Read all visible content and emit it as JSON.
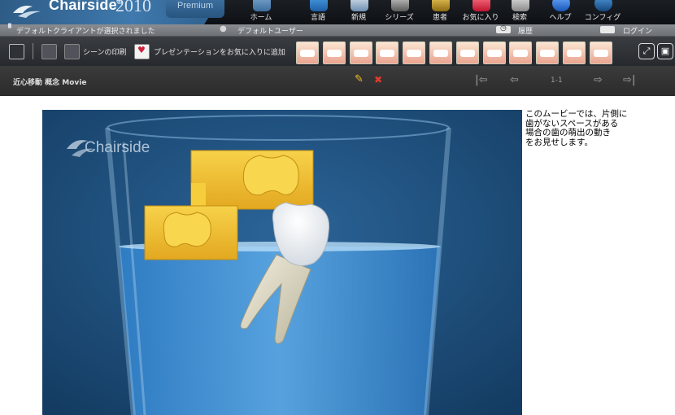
{
  "app": {
    "brand": "Chairside",
    "brand_mark": "®",
    "year": "2010",
    "edition": "Premium"
  },
  "nav": [
    {
      "label": "ホーム",
      "icon": "home-icon"
    },
    {
      "label": "言語",
      "icon": "language-icon"
    },
    {
      "label": "新規",
      "icon": "new-icon"
    },
    {
      "label": "シリーズ",
      "icon": "series-icon"
    },
    {
      "label": "患者",
      "icon": "patient-icon"
    },
    {
      "label": "お気に入り",
      "icon": "favorites-icon"
    },
    {
      "label": "検索",
      "icon": "search-icon"
    },
    {
      "label": "ヘルプ",
      "icon": "help-icon"
    },
    {
      "label": "コンフィグ",
      "icon": "config-icon"
    }
  ],
  "status": {
    "client": "デフォルトクライアントが選択されました",
    "user": "デフォルトユーザー",
    "history": "履歴",
    "login": "ログイン"
  },
  "tools": {
    "print_label": "シーンの印刷",
    "favorite_label": "プレゼンテーションをお気に入りに追加",
    "thumbnail_count": 12
  },
  "player": {
    "breadcrumb": "近心移動 概念 Movie",
    "page": "1-1"
  },
  "movie": {
    "watermark": "Chairside"
  },
  "caption": "このムービーでは、片側に\n歯がないスペースがある\n場合の歯の萌出の動き\nをお見せします。",
  "colors": {
    "accent_blue": "#3f79ad",
    "water": "#4d97d6",
    "scene_bg": "#1c4c78",
    "block": "#f2c12f"
  }
}
